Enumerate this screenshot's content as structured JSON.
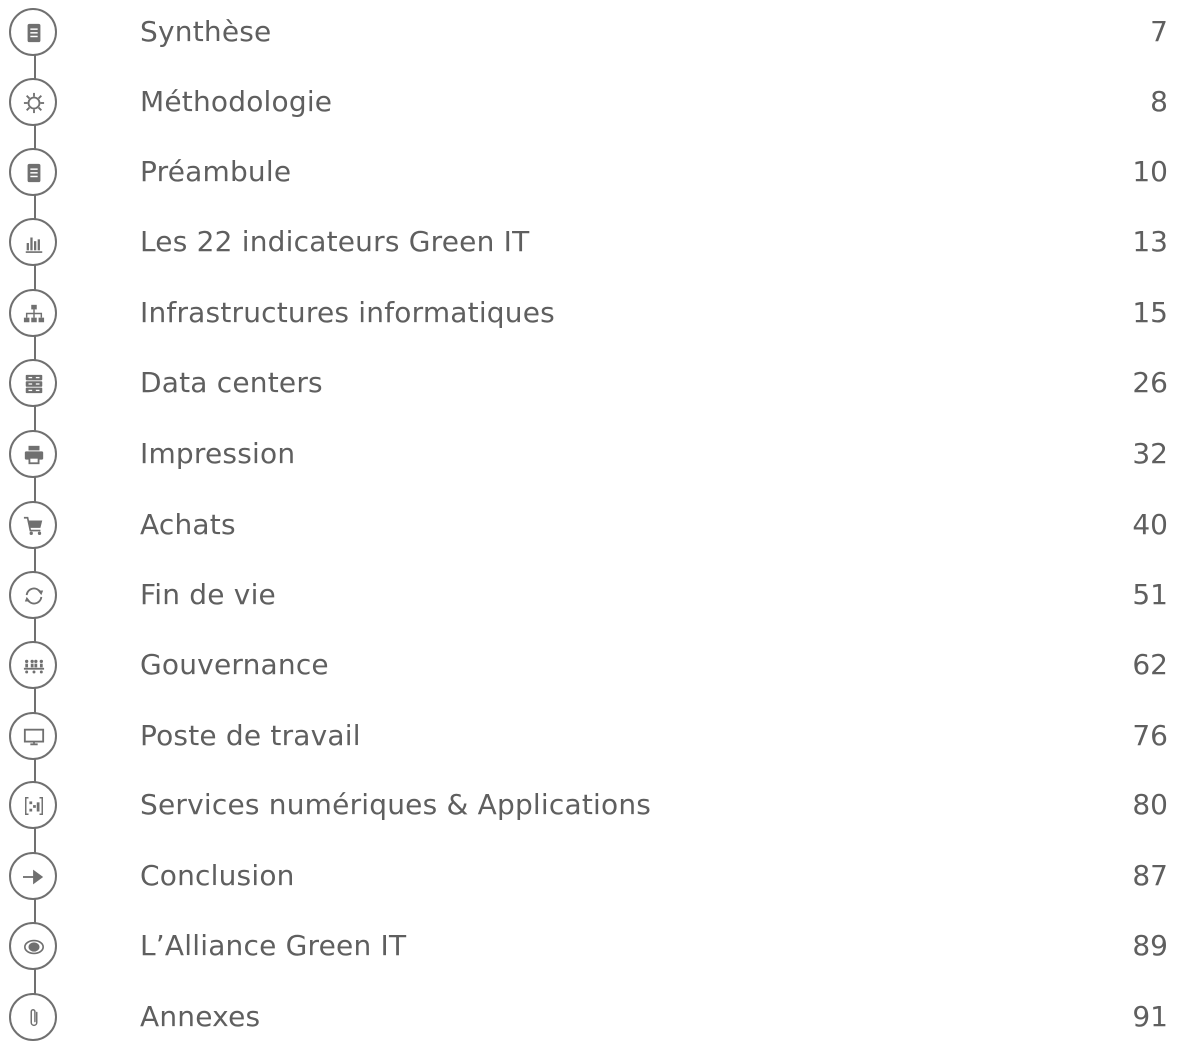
{
  "toc": {
    "items": [
      {
        "icon": "document-icon",
        "title": "Synthèse",
        "page": "7"
      },
      {
        "icon": "gear-icon",
        "title": "Méthodologie",
        "page": "8"
      },
      {
        "icon": "document-icon",
        "title": "Préambule",
        "page": "10"
      },
      {
        "icon": "bar-chart-icon",
        "title": "Les 22 indicateurs Green IT",
        "page": "13"
      },
      {
        "icon": "network-icon",
        "title": "Infrastructures informatiques",
        "page": "15"
      },
      {
        "icon": "server-icon",
        "title": "Data centers",
        "page": "26"
      },
      {
        "icon": "printer-icon",
        "title": "Impression",
        "page": "32"
      },
      {
        "icon": "cart-icon",
        "title": "Achats",
        "page": "40"
      },
      {
        "icon": "recycle-icon",
        "title": "Fin de vie",
        "page": "51"
      },
      {
        "icon": "people-icon",
        "title": "Gouvernance",
        "page": "62"
      },
      {
        "icon": "monitor-icon",
        "title": "Poste de travail",
        "page": "76"
      },
      {
        "icon": "apps-icon",
        "title": "Services numériques & Applications",
        "page": "80"
      },
      {
        "icon": "arrow-right-icon",
        "title": "Conclusion",
        "page": "87"
      },
      {
        "icon": "alliance-icon",
        "title": "L’Alliance Green IT",
        "page": "89"
      },
      {
        "icon": "paperclip-icon",
        "title": "Annexes",
        "page": "91"
      }
    ]
  }
}
